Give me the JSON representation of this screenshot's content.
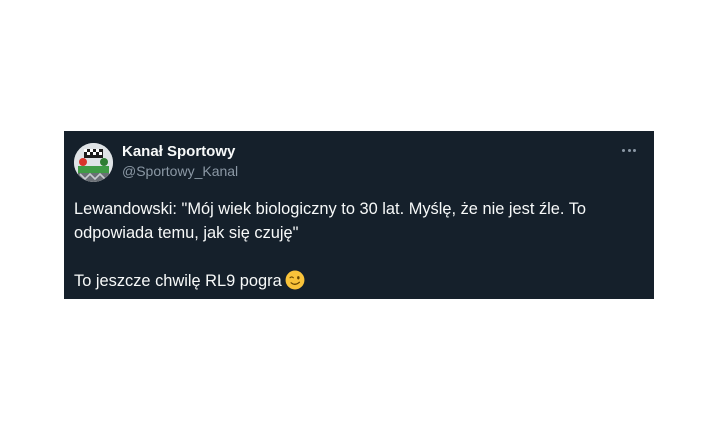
{
  "tweet": {
    "author_name": "Kanał Sportowy",
    "author_handle": "@Sportowy_Kanal",
    "avatar_icon": "kanal-sportowy-logo",
    "more_icon": "ellipsis-horizontal-icon",
    "text_line1": "Lewandowski: \"Mój wiek biologiczny to 30 lat. Myślę, że nie jest źle. To odpowiada temu, jak się czuję\"",
    "text_line2": "To jeszcze chwilę RL9 pogra",
    "emoji": "winking-face-emoji"
  },
  "colors": {
    "card_background": "#15202b",
    "primary_text": "#f7f9f9",
    "secondary_text": "#8b98a5",
    "emoji_yellow": "#f9c33a"
  }
}
